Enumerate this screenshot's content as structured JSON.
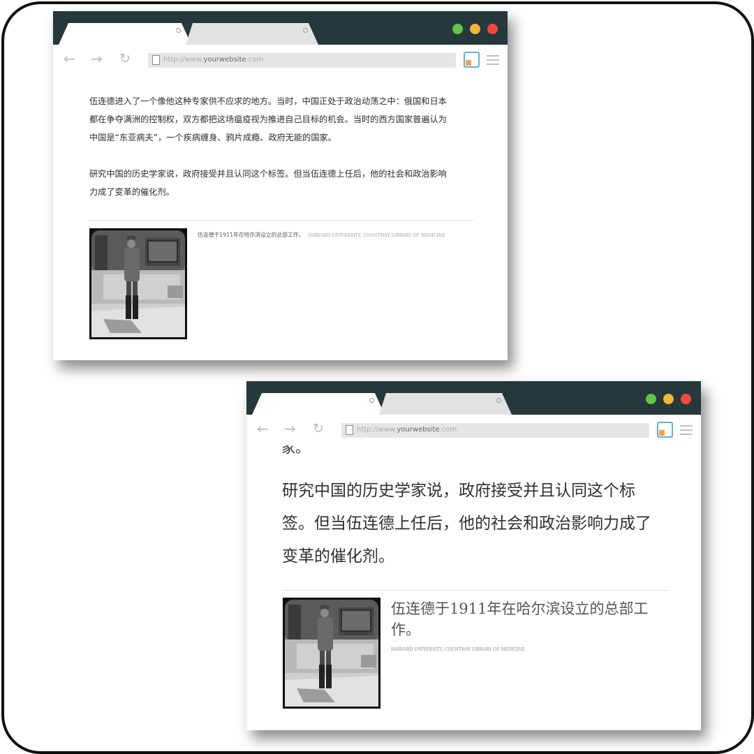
{
  "windows": [
    {
      "url_prefix": "http://www.",
      "url_domain": "yourwebsite",
      "url_suffix": ".com",
      "paragraph1": "伍连德进入了一个像他这种专家供不应求的地方。当时，中国正处于政治动荡之中：俄国和日本都在争夺满洲的控制权，双方都把这场瘟疫视为推进自己目标的机会。当时的西方国家普遍认为中国是“东亚病夫”，一个疾病缠身、鸦片成瘾、政府无能的国家。",
      "paragraph2": "研究中国的历史学家说，政府接受并且认同这个标签。但当伍连德上任后，他的社会和政治影响力成了变革的催化剂。",
      "caption": "伍连德于1911年在哈尔滨设立的总部工作。",
      "credit": "HARVARD UNIVERSITY, COUNTWAY LIBRARY OF MEDICINE"
    },
    {
      "url_prefix": "http://www.",
      "url_domain": "yourwebsite",
      "url_suffix": ".com",
      "clipped_text": "家。",
      "paragraph2": "研究中国的历史学家说，政府接受并且认同这个标签。但当伍连德上任后，他的社会和政治影响力成了变革的催化剂。",
      "caption": "伍连德于1911年在哈尔滨设立的总部工作。",
      "credit": "HARVARD UNIVERSITY, COUNTWAY LIBRARY OF MEDICINE"
    }
  ],
  "icons": {
    "back": "back-arrow-icon",
    "forward": "forward-arrow-icon",
    "reload": "reload-icon",
    "page": "page-icon",
    "extension": "extension-icon",
    "menu": "hamburger-menu-icon"
  },
  "colors": {
    "titlebar": "#25383c",
    "light_green": "#63c54a",
    "light_yellow": "#f0b73a",
    "light_red": "#ee4a3c",
    "tab_active": "#ffffff",
    "tab_inactive": "#e2e2e2"
  }
}
